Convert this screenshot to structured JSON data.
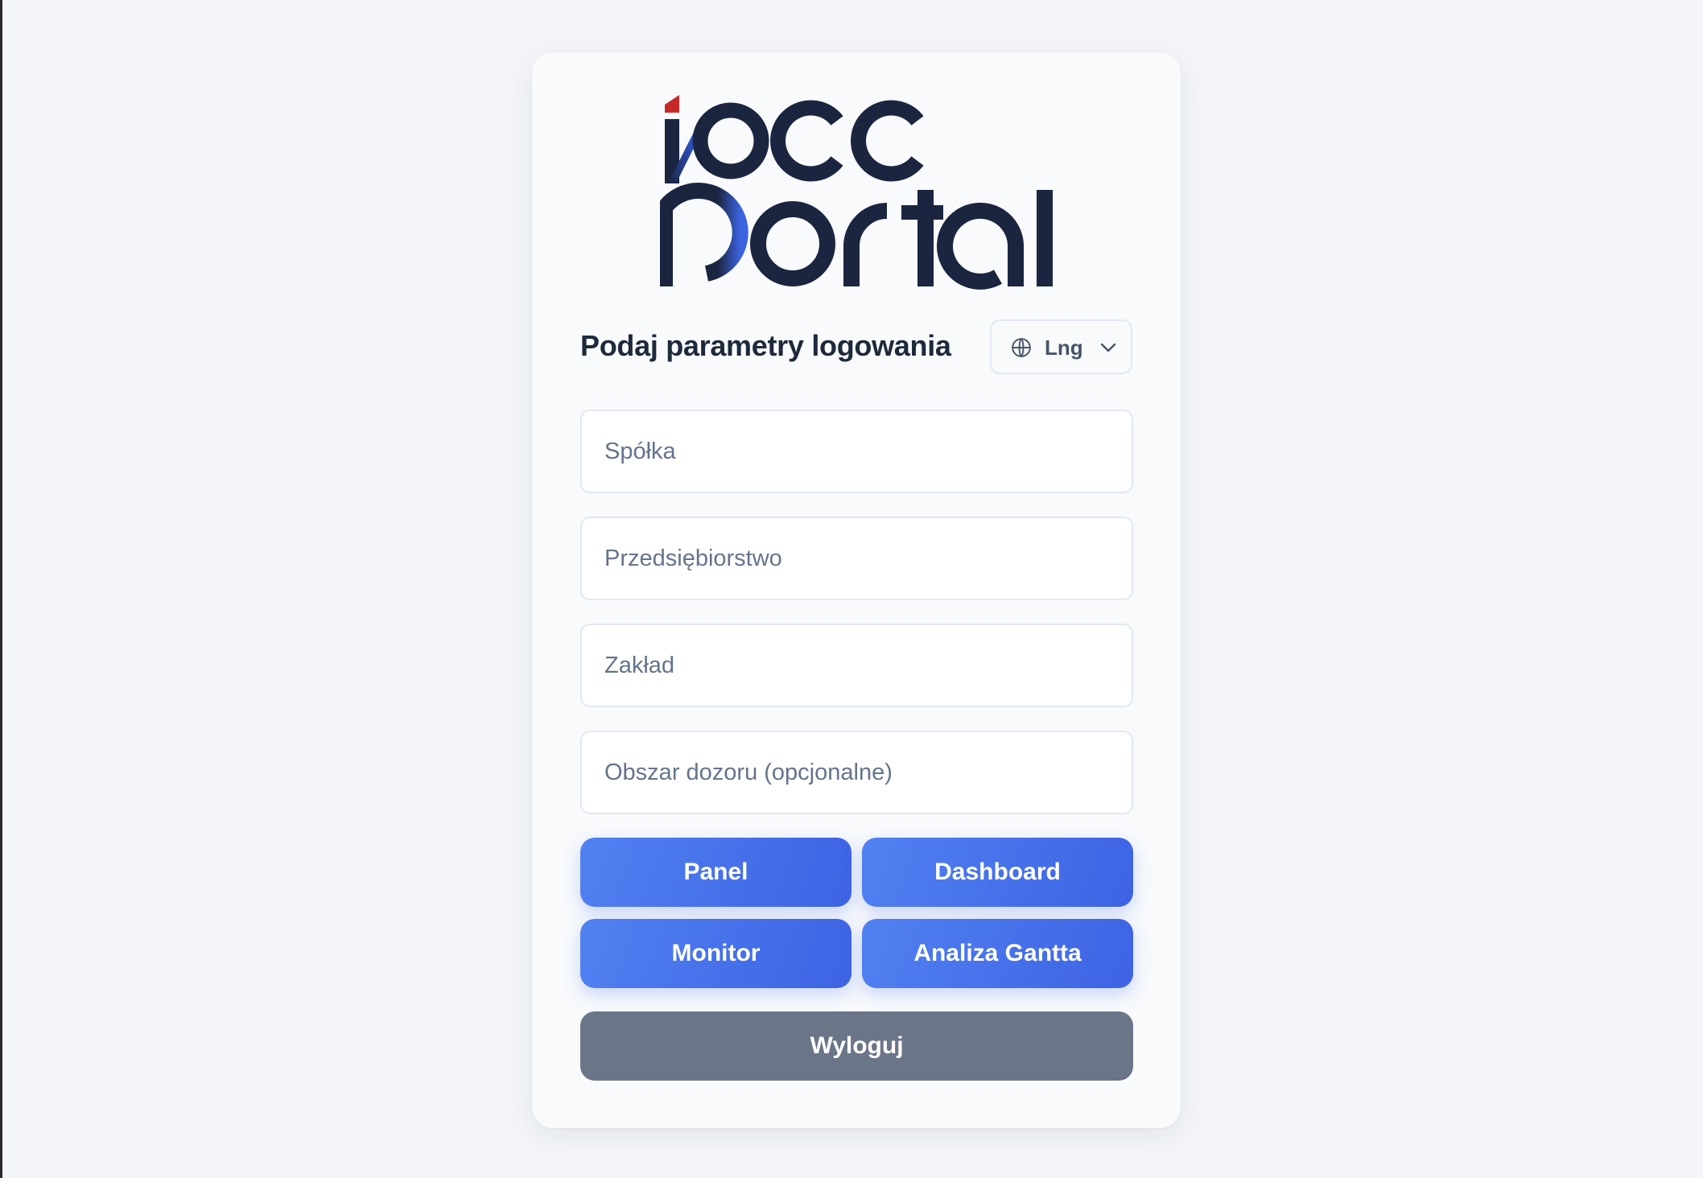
{
  "brand": {
    "logo_line1": "iocc",
    "logo_line2": "portal",
    "colors": {
      "navy": "#1b2540",
      "blue_accent": "#3b63e0",
      "red_accent": "#c62828"
    }
  },
  "login": {
    "heading": "Podaj parametry logowania",
    "language": {
      "label": "Lng",
      "icon": "globe-icon",
      "chevron_icon": "chevron-down-icon"
    },
    "fields": {
      "company": {
        "placeholder": "Spółka",
        "value": ""
      },
      "enterprise": {
        "placeholder": "Przedsiębiorstwo",
        "value": ""
      },
      "plant": {
        "placeholder": "Zakład",
        "value": ""
      },
      "supervision_area": {
        "placeholder": "Obszar dozoru (opcjonalne)",
        "value": ""
      }
    },
    "buttons": {
      "panel": "Panel",
      "dashboard": "Dashboard",
      "monitor": "Monitor",
      "gantt": "Analiza Gantta",
      "logout": "Wyloguj"
    },
    "button_colors": {
      "primary_start": "#5181f1",
      "primary_end": "#3d63e4",
      "secondary": "#6b7588"
    }
  }
}
